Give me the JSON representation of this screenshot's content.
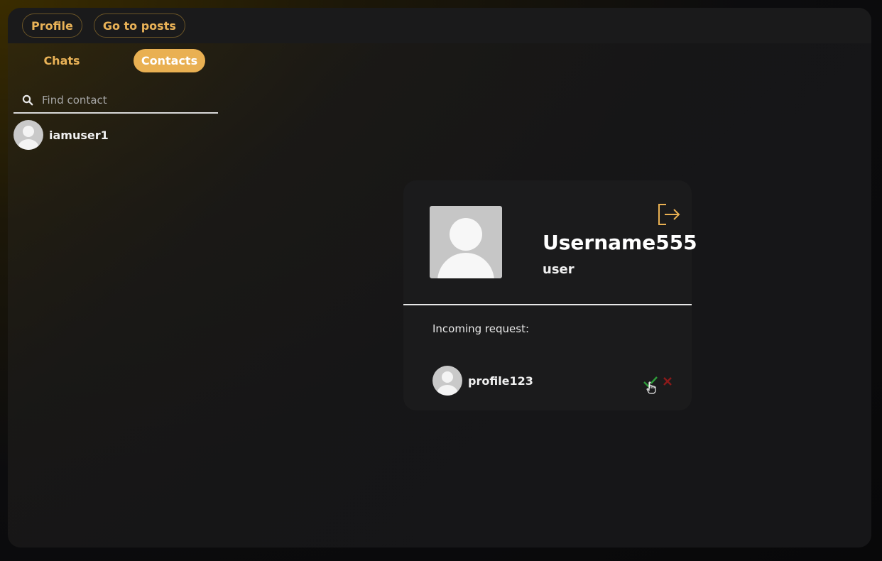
{
  "header": {
    "profile_label": "Profile",
    "posts_label": "Go to posts"
  },
  "tabs": [
    {
      "label": "Chats",
      "active": false
    },
    {
      "label": "Contacts",
      "active": true
    }
  ],
  "search": {
    "placeholder": "Find contact",
    "value": ""
  },
  "contacts": [
    {
      "name": "iamuser1"
    }
  ],
  "profile_card": {
    "username": "Username555",
    "role": "user",
    "logout_icon": "logout-icon",
    "incoming_label": "Incoming request:",
    "requests": [
      {
        "name": "profile123"
      }
    ]
  },
  "colors": {
    "accent": "#e9b052",
    "accept": "#2e9e3a",
    "reject": "#8b1a1a"
  }
}
